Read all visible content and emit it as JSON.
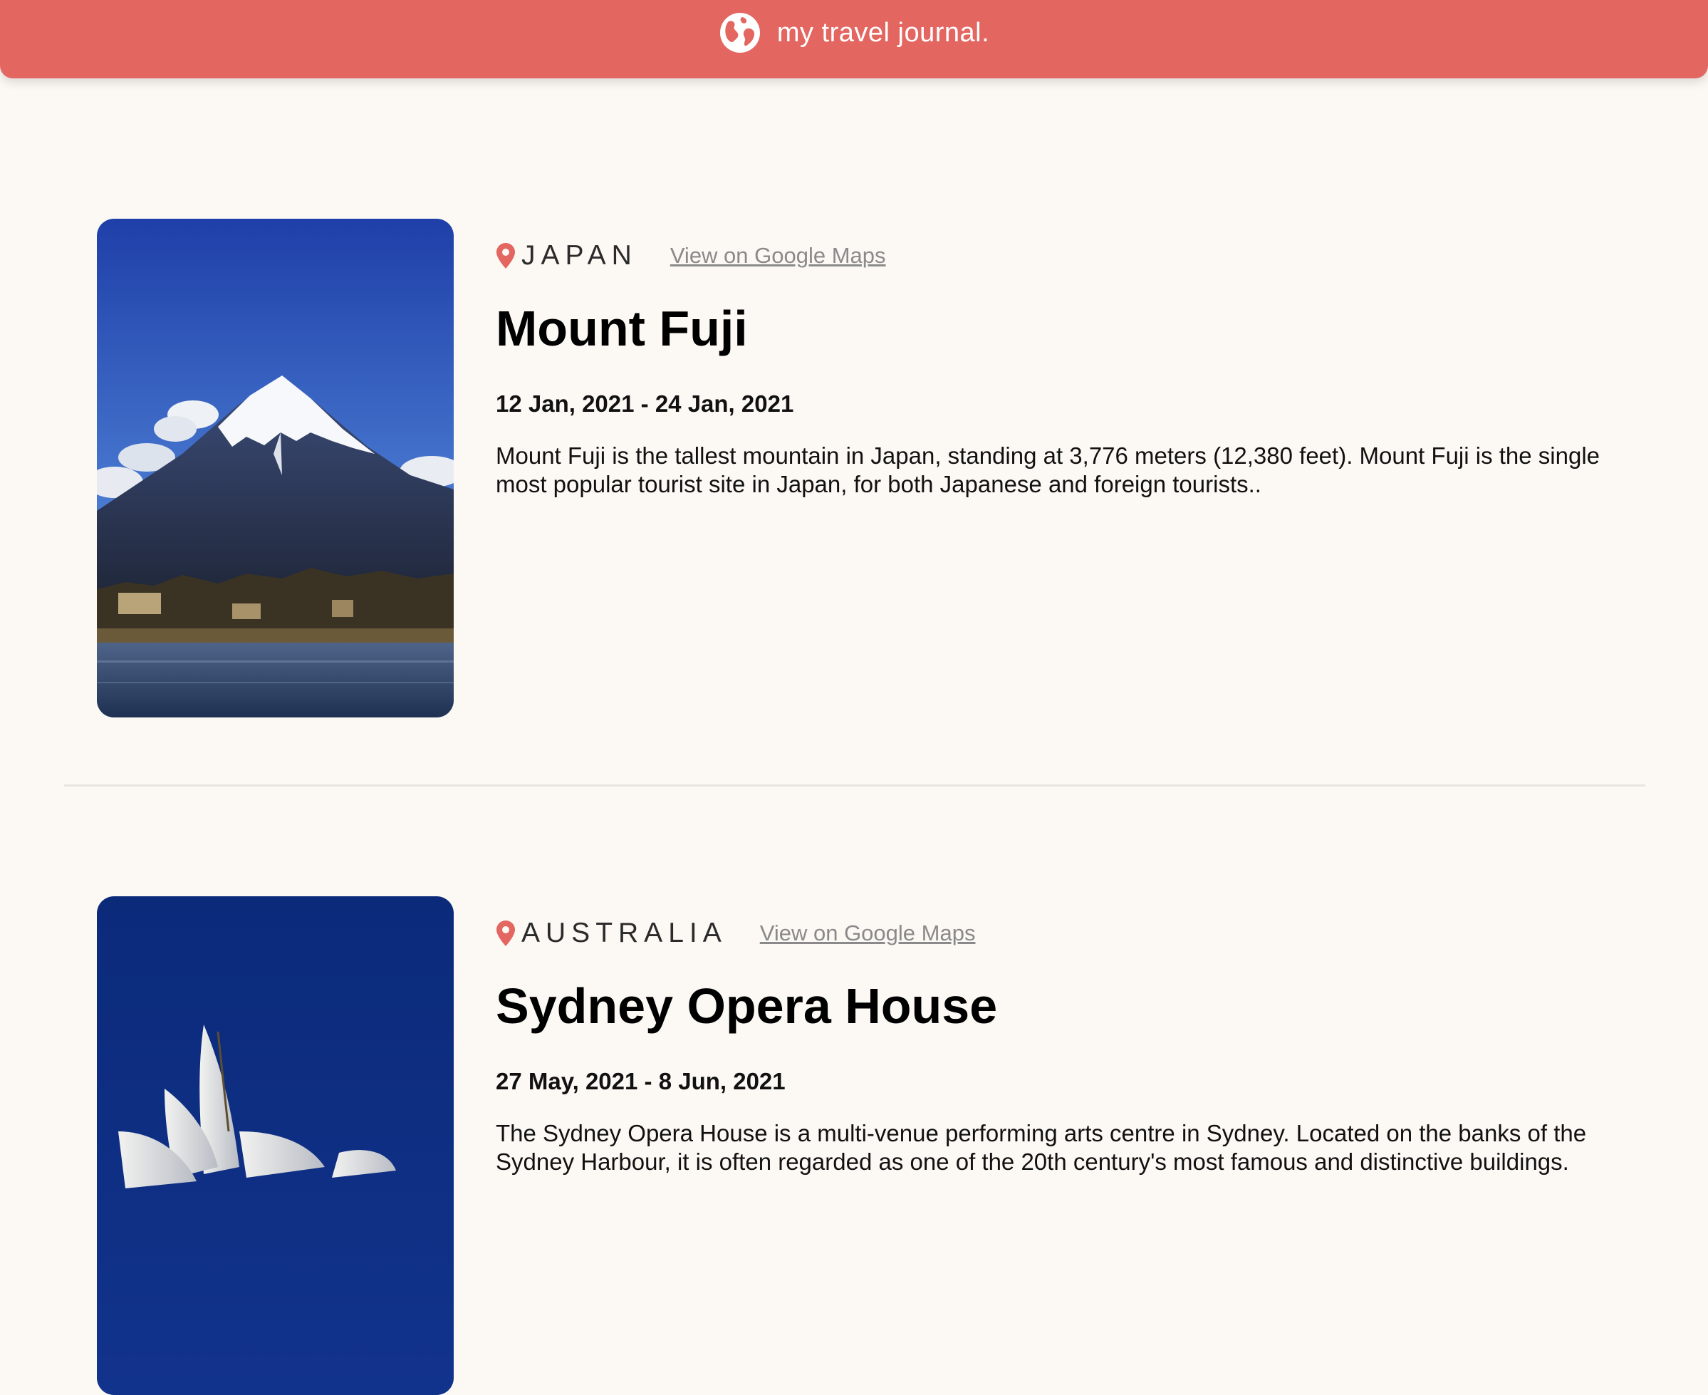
{
  "header": {
    "title": "my travel journal."
  },
  "entries": [
    {
      "country": "JAPAN",
      "maps_link": "View on Google Maps",
      "title": "Mount Fuji",
      "dates": "12 Jan, 2021 - 24 Jan, 2021",
      "description": "Mount Fuji is the tallest mountain in Japan, standing at 3,776 meters (12,380 feet). Mount Fuji is the single most popular tourist site in Japan, for both Japanese and foreign tourists.."
    },
    {
      "country": "AUSTRALIA",
      "maps_link": "View on Google Maps",
      "title": "Sydney Opera House",
      "dates": "27 May, 2021 - 8 Jun, 2021",
      "description": "The Sydney Opera House is a multi-venue performing arts centre in Sydney. Located on the banks of the Sydney Harbour, it is often regarded as one of the 20th century's most famous and distinctive buildings."
    }
  ],
  "icons": {
    "header_icon": "globe-icon",
    "location_icon": "location-pin-icon"
  },
  "colors": {
    "accent": "#E36661",
    "background": "#FCF9F4",
    "link": "#8A8A8A"
  }
}
